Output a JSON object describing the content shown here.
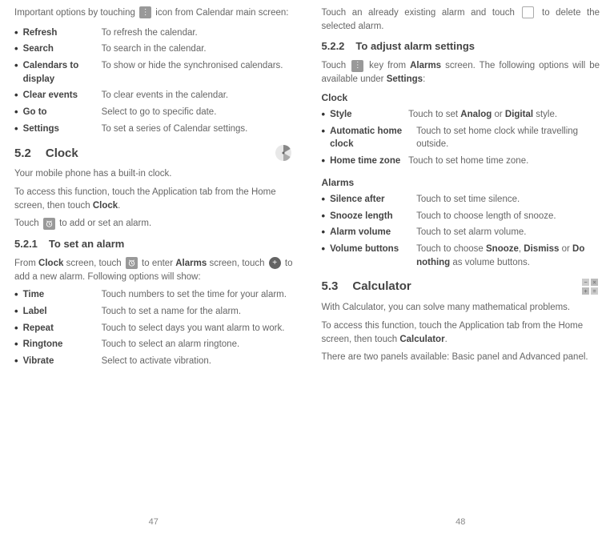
{
  "left": {
    "intro_a": "Important options by touching",
    "intro_b": "icon from Calendar main screen:",
    "opts1": [
      {
        "label": "Refresh",
        "desc": "To refresh the calendar."
      },
      {
        "label": "Search",
        "desc": "To search in the calendar."
      },
      {
        "label": "Calendars to display",
        "desc": "To show or hide  the synchronised calendars."
      },
      {
        "label": "Clear events",
        "desc": "To clear events in the calendar."
      },
      {
        "label": "Go to",
        "desc": "Select to go to specific date."
      },
      {
        "label": "Settings",
        "desc": "To set a series of Calendar settings."
      }
    ],
    "sec52_num": "5.2",
    "sec52_title": "Clock",
    "p1": "Your mobile phone has a built-in clock.",
    "p2a": "To access this function, touch the Application tab from the Home screen, then touch ",
    "p2b": "Clock",
    "p2c": ".",
    "p3a": "Touch ",
    "p3b": " to add or set an alarm.",
    "sub521_num": "5.2.1",
    "sub521_title": "To set an alarm",
    "p4a": "From ",
    "p4b": "Clock",
    "p4c": " screen, touch ",
    "p4d": " to enter ",
    "p4e": "Alarms",
    "p4f": " screen, touch ",
    "p4g": " to add a new alarm. Following options will show:",
    "opts2": [
      {
        "label": "Time",
        "desc": "Touch numbers to set the time for your alarm."
      },
      {
        "label": "Label",
        "desc": "Touch to set a name for the alarm."
      },
      {
        "label": "Repeat",
        "desc": "Touch to select days you want alarm to work."
      },
      {
        "label": "Ringtone",
        "desc": "Touch to select an alarm ringtone."
      },
      {
        "label": "Vibrate",
        "desc": "Select to activate vibration."
      }
    ],
    "page": "47"
  },
  "right": {
    "p1a": "Touch an already existing alarm and touch ",
    "p1b": " to delete the selected alarm.",
    "sub522_num": "5.2.2",
    "sub522_title": "To adjust alarm settings",
    "p2a": "Touch ",
    "p2b": " key from ",
    "p2c": "Alarms",
    "p2d": " screen. The following options will be available under ",
    "p2e": "Settings",
    "p2f": ":",
    "grp1": "Clock",
    "opts1": [
      {
        "label": "Style",
        "desc_a": "Touch to set ",
        "b1": "Analog",
        "mid": " or ",
        "b2": "Digital",
        "desc_b": " style."
      },
      {
        "label": "Automatic home clock",
        "desc": "Touch to set home clock while travelling outside."
      },
      {
        "label": "Home time zone",
        "desc": "Touch to set home time zone."
      }
    ],
    "grp2": "Alarms",
    "opts2": [
      {
        "label": "Silence after",
        "desc": "Touch to set time silence."
      },
      {
        "label": "Snooze length",
        "desc": "Touch to choose length of snooze."
      },
      {
        "label": "Alarm volume",
        "desc": "Touch to set alarm volume."
      },
      {
        "label": "Volume buttons",
        "desc_a": "Touch to choose ",
        "b1": "Snooze",
        "c1": ", ",
        "b2": "Dismiss",
        "c2": " or ",
        "b3": "Do nothing",
        "desc_b": " as volume buttons."
      }
    ],
    "sec53_num": "5.3",
    "sec53_title": "Calculator",
    "p3": "With Calculator, you can solve many mathematical problems.",
    "p4a": "To access this function, touch the Application tab from the Home screen, then touch ",
    "p4b": "Calculator",
    "p4c": ".",
    "p5": "There are two panels available: Basic panel and Advanced panel.",
    "page": "48"
  }
}
